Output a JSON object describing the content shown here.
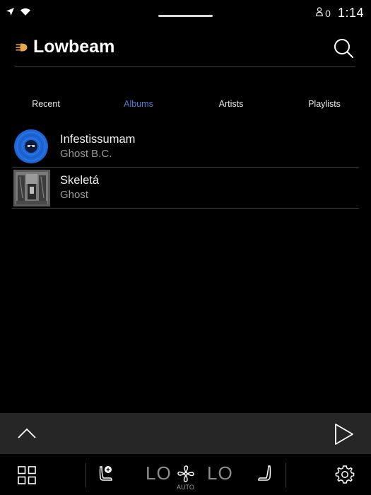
{
  "status_bar": {
    "user_count": "0",
    "time": "1:14"
  },
  "header": {
    "app_title": "Lowbeam"
  },
  "tabs": [
    {
      "label": "Recent",
      "active": false
    },
    {
      "label": "Albums",
      "active": true
    },
    {
      "label": "Artists",
      "active": false
    },
    {
      "label": "Playlists",
      "active": false
    }
  ],
  "albums": [
    {
      "title": "Infestissumam",
      "artist": "Ghost B.C."
    },
    {
      "title": "Skeletá",
      "artist": "Ghost"
    }
  ],
  "climate": {
    "temp_left": "LO",
    "fan_mode": "AUTO",
    "temp_right": "LO"
  },
  "colors": {
    "accent": "#4c7fcf",
    "background": "#000000",
    "player_bar": "#262626",
    "divider": "#3a3a3a"
  },
  "icons": {
    "status_left": [
      "navigation-arrow-icon",
      "wifi-icon"
    ],
    "status_right": [
      "user-icon"
    ],
    "header": [
      "lowbeam-logo-icon",
      "search-icon"
    ],
    "player": [
      "chevron-up-icon",
      "play-icon"
    ],
    "climate": [
      "apps-grid-icon",
      "seat-heat-left-icon",
      "fan-icon",
      "seat-heat-right-icon",
      "settings-gear-icon"
    ]
  }
}
